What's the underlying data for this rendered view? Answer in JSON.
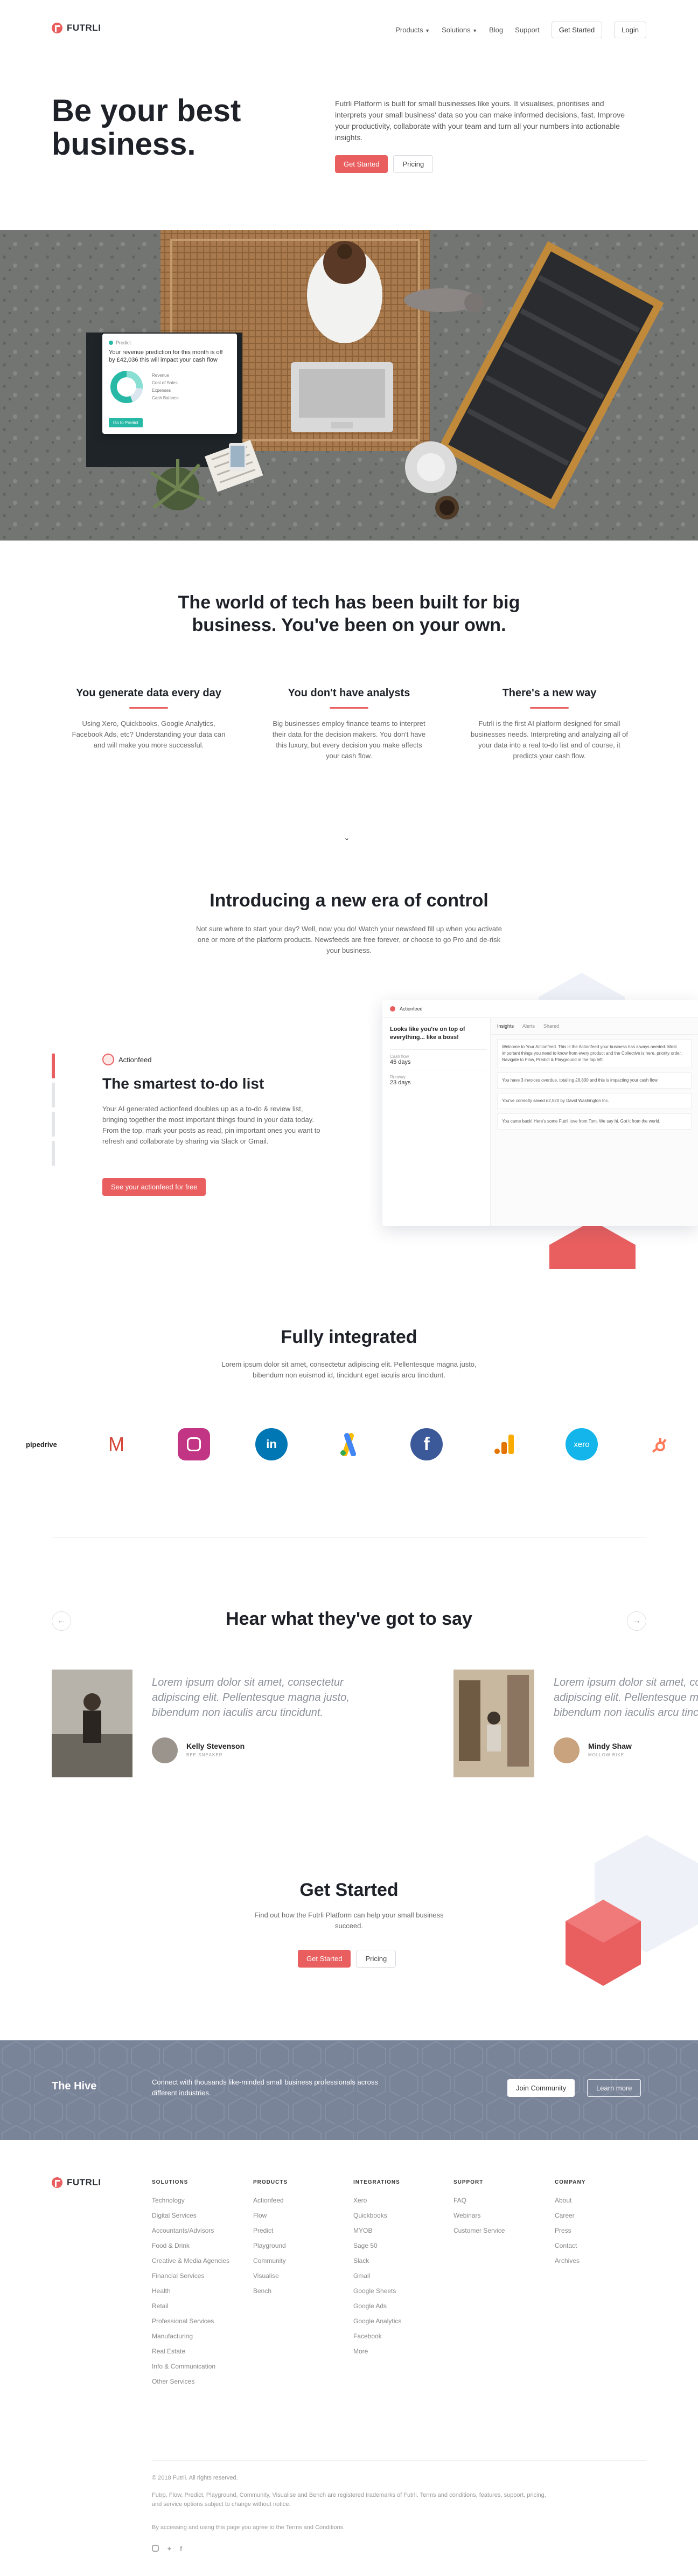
{
  "nav": {
    "brand": "FUTRLI",
    "links": [
      "Products",
      "Solutions",
      "Blog",
      "Support"
    ],
    "get_started": "Get Started",
    "login": "Login"
  },
  "hero": {
    "title": "Be your best business.",
    "copy": "Futrli Platform is built for small businesses like yours. It visualises, prioritises and interprets your small business' data so you can make informed decisions, fast. Improve your productivity, collaborate with your team and turn all your numbers into actionable insights.",
    "cta_primary": "Get Started",
    "cta_secondary": "Pricing"
  },
  "widget": {
    "label": "Predict",
    "text": "Your revenue prediction for this month is off by £42,036 this will impact your cash flow",
    "legend": [
      "Revenue",
      "Cost of Sales",
      "Expenses",
      "Cash Balance"
    ],
    "button": "Go to Predict"
  },
  "tech": {
    "title": "The world of tech has been built for big business. You've been on your own.",
    "columns": [
      {
        "title": "You generate data every day",
        "text": "Using Xero, Quickbooks, Google Analytics, Facebook Ads, etc? Understanding your data can and will make you more successful."
      },
      {
        "title": "You don't have analysts",
        "text": "Big businesses employ finance teams to interpret their data for the decision makers. You don't have this luxury, but every decision you make affects your cash flow."
      },
      {
        "title": "There's a new way",
        "text": "Futrli is the first AI platform designed for small businesses needs. Interpreting and analyzing all of your data into a real to-do list and of course, it predicts your cash flow."
      }
    ]
  },
  "era": {
    "title": "Introducing a new era of control",
    "text": "Not sure where to start your day? Well, now you do! Watch your newsfeed fill up when you activate one or more of the platform products. Newsfeeds are free forever, or choose to go Pro and de-risk your business."
  },
  "actionfeed": {
    "tag": "Actionfeed",
    "title": "The smartest to-do list",
    "text": "Your AI generated actionfeed doubles up as a to-do & review list, bringing together the most important things found in your data today. From the top, mark your posts as read, pin important ones you want to refresh and collaborate by sharing via Slack or Gmail.",
    "button": "See your actionfeed for free",
    "mock": {
      "app_title": "Actionfeed",
      "greeting": "Looks like you're on top of everything... like a boss!",
      "stats": [
        {
          "label": "Cash flow",
          "value": "45 days"
        },
        {
          "label": "Runway",
          "value": "23 days"
        }
      ],
      "tabs": [
        "Insights",
        "Alerts",
        "Shared"
      ],
      "feed": [
        "Welcome to Your Actionfeed. This is the Actionfeed your business has always needed. Most important things you need to know from every product and the Collective is here, priority order. Navigate to Flow, Predict & Playground in the top left.",
        "You have 3 invoices overdue, totalling £6,800 and this is impacting your cash flow.",
        "You've correctly saved £2,520 by David Washington Inc.",
        "You came back! Here's some Futrli love from Tom. We say hi. Got it from the world."
      ]
    }
  },
  "integrated": {
    "title": "Fully integrated",
    "text": "Lorem ipsum dolor sit amet, consectetur adipiscing elit. Pellentesque magna justo, bibendum non euismod id, tincidunt eget iaculis arcu tincidunt.",
    "logos": [
      {
        "name": "pipedrive",
        "color": "#222222"
      },
      {
        "name": "gmail",
        "color": "#d44638"
      },
      {
        "name": "instagram",
        "color": "#c13584"
      },
      {
        "name": "linkedin",
        "color": "#0077b5"
      },
      {
        "name": "google-ads",
        "color": "#4285f4"
      },
      {
        "name": "facebook",
        "color": "#3b5998"
      },
      {
        "name": "google-analytics",
        "color": "#f9ab00"
      },
      {
        "name": "xero",
        "color": "#13b5ea"
      },
      {
        "name": "hubspot",
        "color": "#ff7a59"
      }
    ],
    "pipedrive_label": "pipedrive",
    "linkedin_label": "in",
    "facebook_label": "f",
    "xero_label": "xero"
  },
  "testimonials": {
    "title": "Hear what they've got to say",
    "items": [
      {
        "quote": "Lorem ipsum dolor sit amet, consectetur adipiscing elit. Pellentesque magna justo, bibendum non iaculis arcu tincidunt.",
        "name": "Kelly Stevenson",
        "role": "BEE SNEAKER"
      },
      {
        "quote": "Lorem ipsum dolor sit amet, consectetur adipiscing elit. Pellentesque magna justo, bibendum non iaculis arcu tincidunt.",
        "name": "Mindy Shaw",
        "role": "MOLLOW BIKE"
      }
    ]
  },
  "get_started": {
    "title": "Get Started",
    "text": "Find out how the Futrli Platform can help your small business succeed.",
    "cta_primary": "Get Started",
    "cta_secondary": "Pricing"
  },
  "hive": {
    "title": "The Hive",
    "text": "Connect with thousands like-minded small business professionals across different industries.",
    "join": "Join Community",
    "learn": "Learn more"
  },
  "footer": {
    "brand": "FUTRLI",
    "columns": [
      {
        "title": "SOLUTIONS",
        "items": [
          "Technology",
          "Digital Services",
          "Accountants/Advisors",
          "Food & Drink",
          "Creative & Media Agencies",
          "Financial Services",
          "Health",
          "Retail",
          "Professional Services",
          "Manufacturing",
          "Real Estate",
          "Info & Communication",
          "Other Services"
        ]
      },
      {
        "title": "PRODUCTS",
        "items": [
          "Actionfeed",
          "Flow",
          "Predict",
          "Playground",
          "Community",
          "Visualise",
          "Bench"
        ]
      },
      {
        "title": "INTEGRATIONS",
        "items": [
          "Xero",
          "Quickbooks",
          "MYOB",
          "Sage 50",
          "Slack",
          "Gmail",
          "Google Sheets",
          "Google Ads",
          "Google Analytics",
          "Facebook",
          "More"
        ]
      },
      {
        "title": "SUPPORT",
        "items": [
          "FAQ",
          "Webinars",
          "Customer Service"
        ]
      },
      {
        "title": "COMPANY",
        "items": [
          "About",
          "Career",
          "Press",
          "Contact",
          "Archives"
        ]
      }
    ],
    "copyright": "© 2018 Futrli. All rights reserved.",
    "legal": "Futrp, Flow, Predict, Playground, Community, Visualise and Bench are registered trademarks of Futrli. Terms and conditions, features, support, pricing, and service options subject to change without notice.",
    "terms": "By accessing and using this page you agree to the Terms and Conditions."
  },
  "colors": {
    "accent": "#e95f60",
    "hive": "#7a8499",
    "text": "#2b2f36"
  }
}
